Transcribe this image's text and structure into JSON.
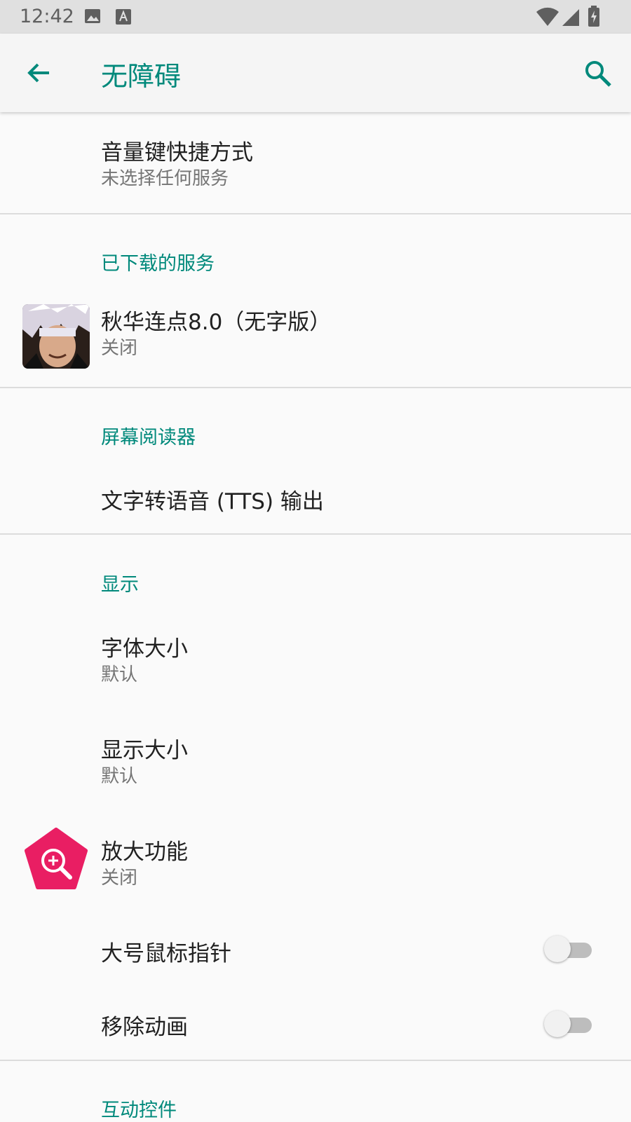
{
  "status_bar": {
    "time": "12:42",
    "icons": [
      "image-icon",
      "text-a-icon",
      "wifi-icon",
      "signal-icon",
      "battery-charging-icon"
    ]
  },
  "toolbar": {
    "title": "无障碍",
    "back_icon": "arrow-back-icon",
    "search_icon": "search-icon"
  },
  "colors": {
    "accent": "#00897b",
    "primary_text": "#212121",
    "secondary_text": "#757575",
    "background": "#fafafa",
    "magnify_icon": "#e91e63"
  },
  "items": {
    "volume_shortcut": {
      "title": "音量键快捷方式",
      "summary": "未选择任何服务"
    },
    "downloaded_header": "已下载的服务",
    "qiuhua": {
      "title": "秋华连点8.0（无字版）",
      "summary": "关闭"
    },
    "screen_reader_header": "屏幕阅读器",
    "tts": {
      "title": "文字转语音 (TTS) 输出"
    },
    "display_header": "显示",
    "font_size": {
      "title": "字体大小",
      "summary": "默认"
    },
    "display_size": {
      "title": "显示大小",
      "summary": "默认"
    },
    "magnification": {
      "title": "放大功能",
      "summary": "关闭"
    },
    "large_pointer": {
      "title": "大号鼠标指针",
      "checked": false
    },
    "remove_animations": {
      "title": "移除动画",
      "checked": false
    },
    "interaction_header": "互动控件"
  }
}
